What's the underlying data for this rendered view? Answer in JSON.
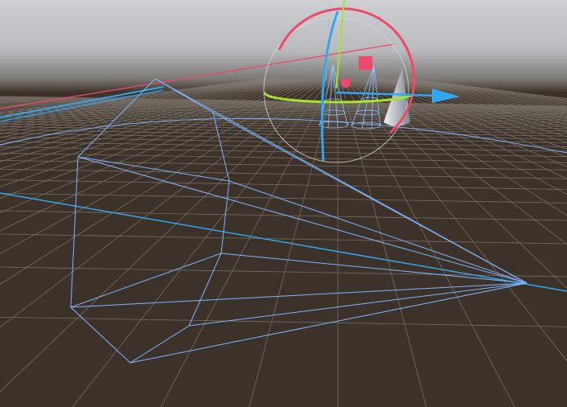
{
  "viewport": {
    "colors": {
      "sky_top": "#c9cacd",
      "horizon": "#8f8f90",
      "ground": "#3c3229",
      "grid": "#8a8178",
      "x_axis": "#f0486a",
      "y_axis": "#a6e22e",
      "z_axis": "#33a6f0",
      "frustum": "#7fb6ff",
      "rotate_ring": "#d8d8d8",
      "mesh": "#b8c0cc"
    }
  }
}
